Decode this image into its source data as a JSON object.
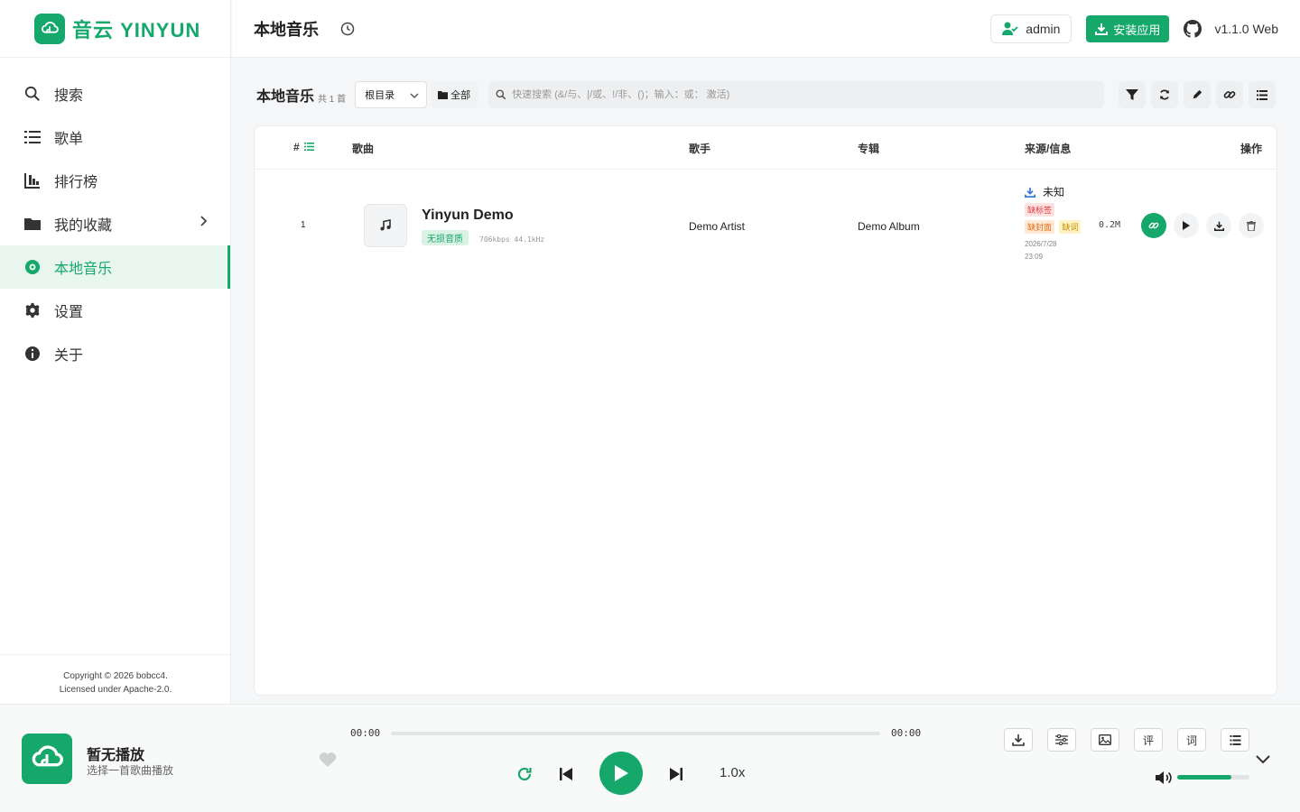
{
  "app": {
    "brand": "音云 YINYUN",
    "version": "v1.1.0 Web"
  },
  "sidebar": {
    "items": [
      {
        "label": "搜索",
        "icon": "search-icon"
      },
      {
        "label": "歌单",
        "icon": "list-icon"
      },
      {
        "label": "排行榜",
        "icon": "chart-icon"
      },
      {
        "label": "我的收藏",
        "icon": "folder-icon"
      },
      {
        "label": "本地音乐",
        "icon": "disc-icon",
        "active": true
      },
      {
        "label": "设置",
        "icon": "gear-icon"
      },
      {
        "label": "关于",
        "icon": "info-icon"
      }
    ],
    "copyright_line1": "Copyright © 2026 bobcc4.",
    "copyright_line2": "Licensed under Apache-2.0."
  },
  "header": {
    "title": "本地音乐",
    "user_label": "admin",
    "install_label": "安装应用"
  },
  "toolbar": {
    "title": "本地音乐",
    "count": "共 1 首",
    "directory": "根目录",
    "scope": "全部",
    "search_placeholder": "快速搜索 (&/与、|/或、!/非、()；输入：或： 激活)"
  },
  "table": {
    "columns": {
      "index": "#",
      "song": "歌曲",
      "artist": "歌手",
      "album": "专辑",
      "source": "来源/信息",
      "actions": "操作"
    },
    "rows": [
      {
        "index": "1",
        "title": "Yinyun Demo",
        "quality_badge": "无损音质",
        "bitrate": "706kbps 44.1kHz",
        "artist": "Demo Artist",
        "album": "Demo Album",
        "source": "未知",
        "tag_missing_tags": "缺标签",
        "tag_missing_cover": "缺封面",
        "tag_missing_lyrics": "缺词",
        "size": "0.2M",
        "date": "2026/7/28",
        "time": "23:09"
      }
    ]
  },
  "player": {
    "title": "暂无播放",
    "subtitle": "选择一首歌曲播放",
    "current_time": "00:00",
    "total_time": "00:00",
    "progress": 0,
    "speed": "1.0x",
    "comment_label": "评",
    "lyrics_label": "词",
    "volume": 0.75
  },
  "colors": {
    "accent": "#16a86b",
    "tag_red": "#e03a3a",
    "tag_orange": "#e46a12",
    "tag_yellow": "#c59100"
  }
}
